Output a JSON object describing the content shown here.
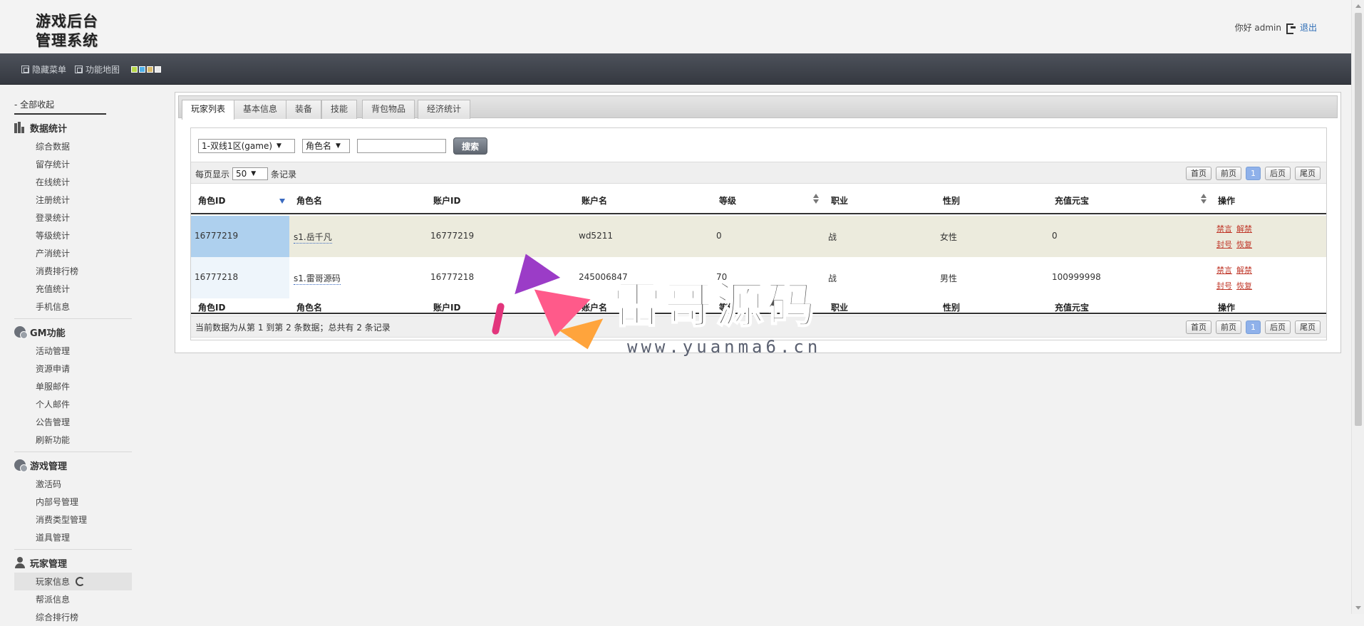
{
  "header": {
    "logo_line1": "游戏后台",
    "logo_line2": "管理系统",
    "greeting": "你好 admin",
    "logout_label": "退出"
  },
  "topbar": {
    "hide_menu": "隐藏菜单",
    "function_map": "功能地图",
    "theme_colors": [
      "#b8d84a",
      "#4fb0e8",
      "#d8b96a",
      "#e8e8e8"
    ]
  },
  "sidebar": {
    "collapse_all": "- 全部收起",
    "groups": [
      {
        "title": "数据统计",
        "icon": "bar-chart-icon",
        "items": [
          "综合数据",
          "留存统计",
          "在线统计",
          "注册统计",
          "登录统计",
          "等级统计",
          "产消统计",
          "消费排行榜",
          "充值统计",
          "手机信息"
        ]
      },
      {
        "title": "GM功能",
        "icon": "gear-icon",
        "items": [
          "活动管理",
          "资源申请",
          "单服邮件",
          "个人邮件",
          "公告管理",
          "刷新功能"
        ]
      },
      {
        "title": "游戏管理",
        "icon": "gear-icon",
        "items": [
          "激活码",
          "内部号管理",
          "消费类型管理",
          "道具管理"
        ]
      },
      {
        "title": "玩家管理",
        "icon": "user-icon",
        "items": [
          "玩家信息",
          "帮派信息",
          "综合排行榜"
        ]
      }
    ]
  },
  "tabs": [
    "玩家列表",
    "基本信息",
    "装备",
    "技能",
    "背包物品",
    "经济统计"
  ],
  "search": {
    "server": "1-双线1区(game)",
    "field": "角色名",
    "query": "",
    "button": "搜索"
  },
  "page_size": {
    "prefix": "每页显示",
    "value": "50",
    "suffix": "条记录"
  },
  "pager": {
    "first": "首页",
    "prev": "前页",
    "current": "1",
    "next": "后页",
    "last": "尾页"
  },
  "table": {
    "columns": [
      "角色ID",
      "角色名",
      "账户ID",
      "账户名",
      "等级",
      "职业",
      "性别",
      "充值元宝",
      "操作"
    ],
    "rows": [
      {
        "role_id": "16777219",
        "role_name": "s1.岳千凡",
        "account_id": "16777219",
        "account_name": "wd5211",
        "level": "0",
        "job": "战",
        "gender": "女性",
        "gold": "0",
        "ops": [
          "禁言",
          "解禁",
          "封号",
          "恢复"
        ]
      },
      {
        "role_id": "16777218",
        "role_name": "s1.雷哥源码",
        "account_id": "16777218",
        "account_name": "245006847",
        "level": "70",
        "job": "战",
        "gender": "男性",
        "gold": "100999998",
        "ops": [
          "禁言",
          "解禁",
          "封号",
          "恢复"
        ]
      }
    ],
    "summary": "当前数据为从第 1 到第 2 条数据；总共有 2 条记录"
  },
  "watermark": {
    "title": "雷哥源码",
    "url": "www.yuanma6.cn"
  }
}
